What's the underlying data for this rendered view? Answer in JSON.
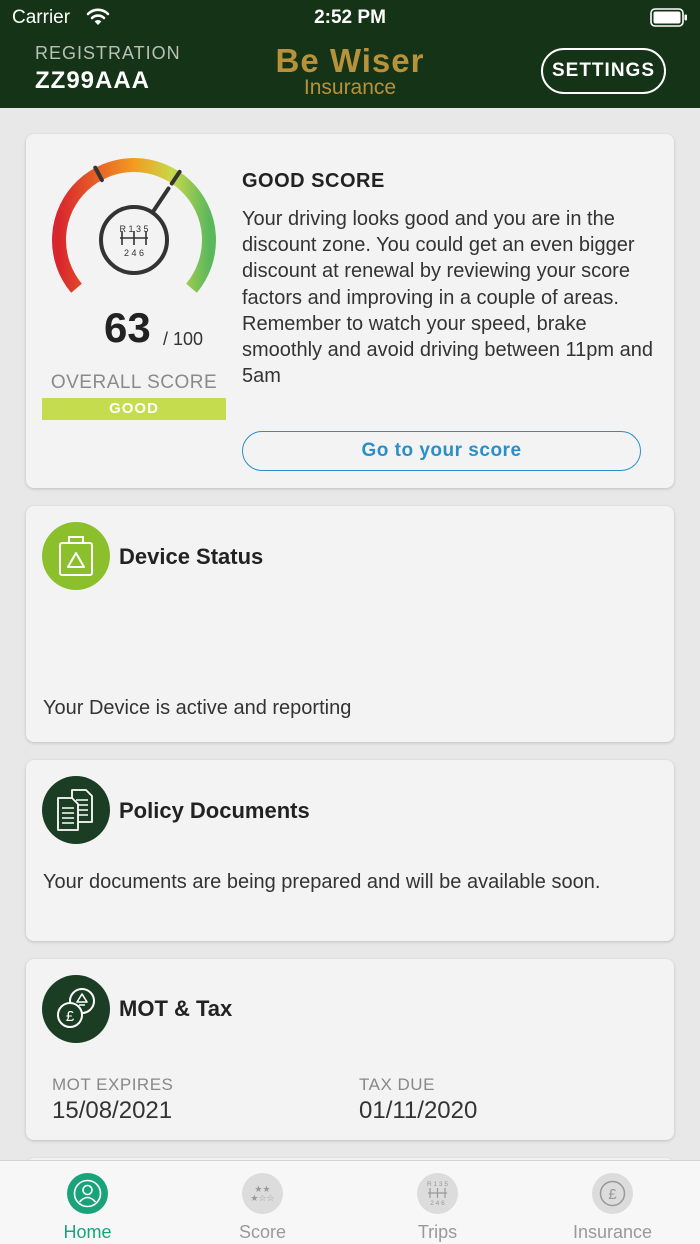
{
  "status_bar": {
    "carrier": "Carrier",
    "time": "2:52 PM"
  },
  "header": {
    "registration_label": "REGISTRATION",
    "registration_value": "ZZ99AAA",
    "logo_top": "Be Wiser",
    "logo_bottom": "Insurance",
    "settings_label": "SETTINGS"
  },
  "score_card": {
    "score": "63",
    "score_max": "/ 100",
    "score_fraction": 0.63,
    "overall_label": "OVERALL SCORE",
    "badge": "GOOD",
    "gear_top": "R 1 3 5",
    "gear_bottom": "2 4 6",
    "title": "GOOD SCORE",
    "description": "Your driving looks good and you are in the discount zone. You could get an even bigger discount at renewal by reviewing your score factors and improving in a couple of areas. Remember to watch your speed, brake smoothly and avoid driving between 11pm and 5am",
    "button_label": "Go to your score",
    "colors": {
      "low": "#d9262e",
      "mid": "#f39b1f",
      "high": "#5cb85c"
    }
  },
  "device_card": {
    "title": "Device Status",
    "text": "Your Device is active and reporting"
  },
  "docs_card": {
    "title": "Policy Documents",
    "text": "Your documents are being prepared and will be available soon."
  },
  "mot_card": {
    "title": "MOT & Tax",
    "mot_label": "MOT EXPIRES",
    "mot_value": "15/08/2021",
    "tax_label": "TAX DUE",
    "tax_value": "01/11/2020"
  },
  "tabs": [
    {
      "label": "Home",
      "icon": "home-icon",
      "active": true
    },
    {
      "label": "Score",
      "icon": "score-icon",
      "active": false
    },
    {
      "label": "Trips",
      "icon": "trips-icon",
      "active": false
    },
    {
      "label": "Insurance",
      "icon": "insurance-icon",
      "active": false
    }
  ],
  "accent_color": "#1aa37a",
  "header_color": "#153316"
}
